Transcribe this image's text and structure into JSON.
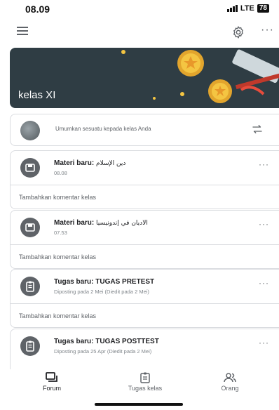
{
  "status_bar": {
    "time": "08.09",
    "network": "LTE",
    "battery": "78"
  },
  "app_bar": {
    "menu_icon": "menu-icon",
    "settings_icon": "gear-icon",
    "more_icon": "more-vert-icon"
  },
  "banner": {
    "class_name": "kelas XI"
  },
  "announce": {
    "placeholder": "Umumkan sesuatu kepada kelas Anda"
  },
  "posts": [
    {
      "icon": "material-icon",
      "label": "Materi baru: ",
      "title": "دين الإسلام",
      "time": "08.08",
      "comment": "Tambahkan komentar kelas"
    },
    {
      "icon": "material-icon",
      "label": "Materi baru: ",
      "title": "الاديان في إندونيسيا",
      "time": "07.53",
      "comment": "Tambahkan komentar kelas"
    },
    {
      "icon": "assignment-icon",
      "label": "Tugas baru: ",
      "title": "TUGAS PRETEST",
      "time": "Diposting pada 2 Mei (Diedit pada 2 Mei)",
      "comment": "Tambahkan komentar kelas"
    },
    {
      "icon": "assignment-icon",
      "label": "Tugas baru: ",
      "title": "TUGAS POSTTEST",
      "time": "Diposting pada 25 Apr (Diedit pada 2 Mei)"
    }
  ],
  "bottom_nav": {
    "forum": "Forum",
    "classwork": "Tugas kelas",
    "people": "Orang"
  },
  "colors": {
    "banner": "#2f3d44",
    "post_icon": "#5f6368",
    "border": "#dadce0"
  }
}
